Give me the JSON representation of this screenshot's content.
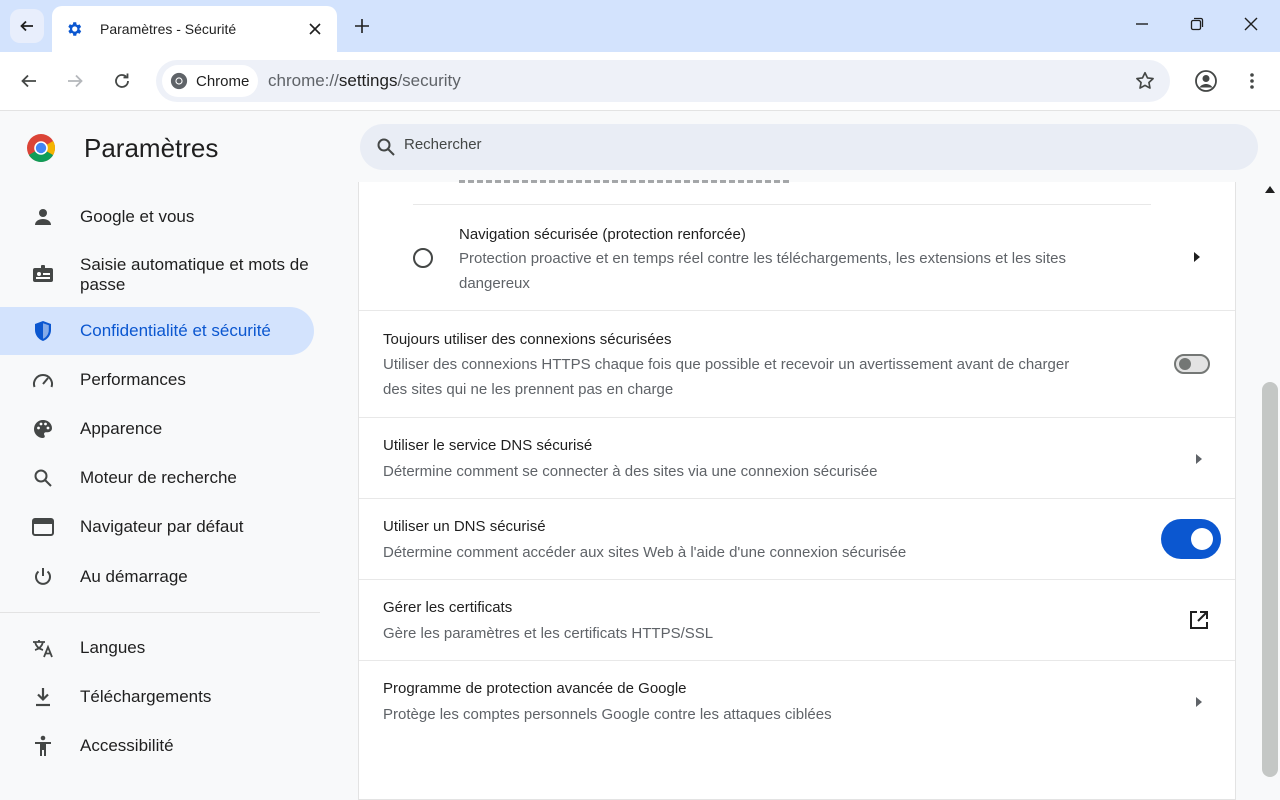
{
  "browser": {
    "tab_title": "Paramètres - Sécurité",
    "chip_label": "Chrome",
    "url_scheme": "chrome://",
    "url_host": "settings",
    "url_path": "/security"
  },
  "settings": {
    "title": "Paramètres",
    "search_placeholder": "Rechercher"
  },
  "sidebar": {
    "items": [
      {
        "label": "Google et vous",
        "icon": "person-icon"
      },
      {
        "label": "Saisie automatique et mots de passe",
        "icon": "autofill-icon"
      },
      {
        "label": "Confidentialité et sécurité",
        "icon": "shield-icon",
        "active": true
      },
      {
        "label": "Performances",
        "icon": "speedometer-icon"
      },
      {
        "label": "Apparence",
        "icon": "palette-icon"
      },
      {
        "label": "Moteur de recherche",
        "icon": "search-icon"
      },
      {
        "label": "Navigateur par défaut",
        "icon": "browser-icon"
      },
      {
        "label": "Au démarrage",
        "icon": "power-icon"
      },
      {
        "label": "Langues",
        "icon": "translate-icon"
      },
      {
        "label": "Téléchargements",
        "icon": "download-icon"
      },
      {
        "label": "Accessibilité",
        "icon": "accessibility-icon"
      }
    ]
  },
  "content": {
    "enhanced_protection": {
      "title": "Navigation sécurisée (protection renforcée)",
      "desc_line1": "Protection proactive et en temps réel contre les téléchargements, les extensions et les sites",
      "desc_line2": "dangereux"
    },
    "https_always": {
      "title": "Toujours utiliser des connexions sécurisées",
      "desc_line1": "Utiliser des connexions HTTPS chaque fois que possible et recevoir un avertissement avant de charger",
      "desc_line2": "des sites qui ne les prennent pas en charge",
      "enabled": false
    },
    "secure_dns_service": {
      "title": "Utiliser le service DNS sécurisé",
      "desc": "Détermine comment se connecter à des sites via une connexion sécurisée"
    },
    "secure_dns": {
      "title": "Utiliser un DNS sécurisé",
      "desc": "Détermine comment accéder aux sites Web à l'aide d'une connexion sécurisée",
      "enabled": true
    },
    "certificates": {
      "title": "Gérer les certificats",
      "desc": "Gère les paramètres et les certificats HTTPS/SSL"
    },
    "advanced_protection": {
      "title": "Programme de protection avancée de Google",
      "desc": "Protège les comptes personnels Google contre les attaques ciblées"
    }
  },
  "colors": {
    "accent": "#0b57d0",
    "active_nav_bg": "#d3e3fd",
    "tabstrip_bg": "#d3e3fd"
  }
}
